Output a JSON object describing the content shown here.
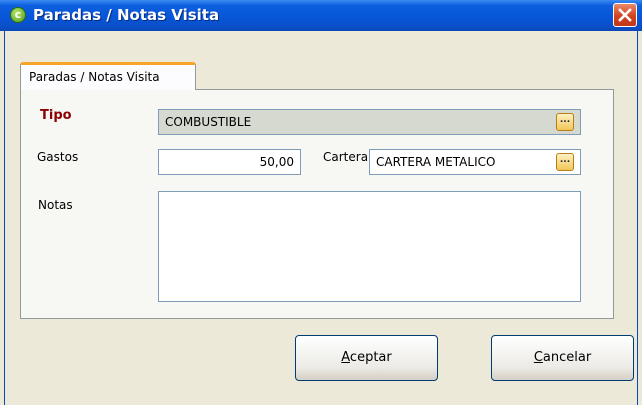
{
  "window": {
    "title": "Paradas / Notas Visita",
    "app_icon_letter": "c"
  },
  "tab": {
    "label": "Paradas / Notas Visita"
  },
  "form": {
    "tipo": {
      "label": "Tipo",
      "value": "COMBUSTIBLE"
    },
    "gastos": {
      "label": "Gastos",
      "value": "50,00"
    },
    "cartera": {
      "label": "Cartera",
      "value": "CARTERA METALICO"
    },
    "notas": {
      "label": "Notas",
      "value": ""
    }
  },
  "buttons": {
    "aceptar": {
      "accel": "A",
      "rest": "ceptar"
    },
    "cancelar": {
      "accel": "C",
      "rest": "ancelar"
    },
    "browse_label": "..."
  },
  "colors": {
    "titlebar": "#0755d6",
    "tipo_label": "#8b0000",
    "tab_highlight": "#f6a429",
    "close": "#d2431f"
  }
}
